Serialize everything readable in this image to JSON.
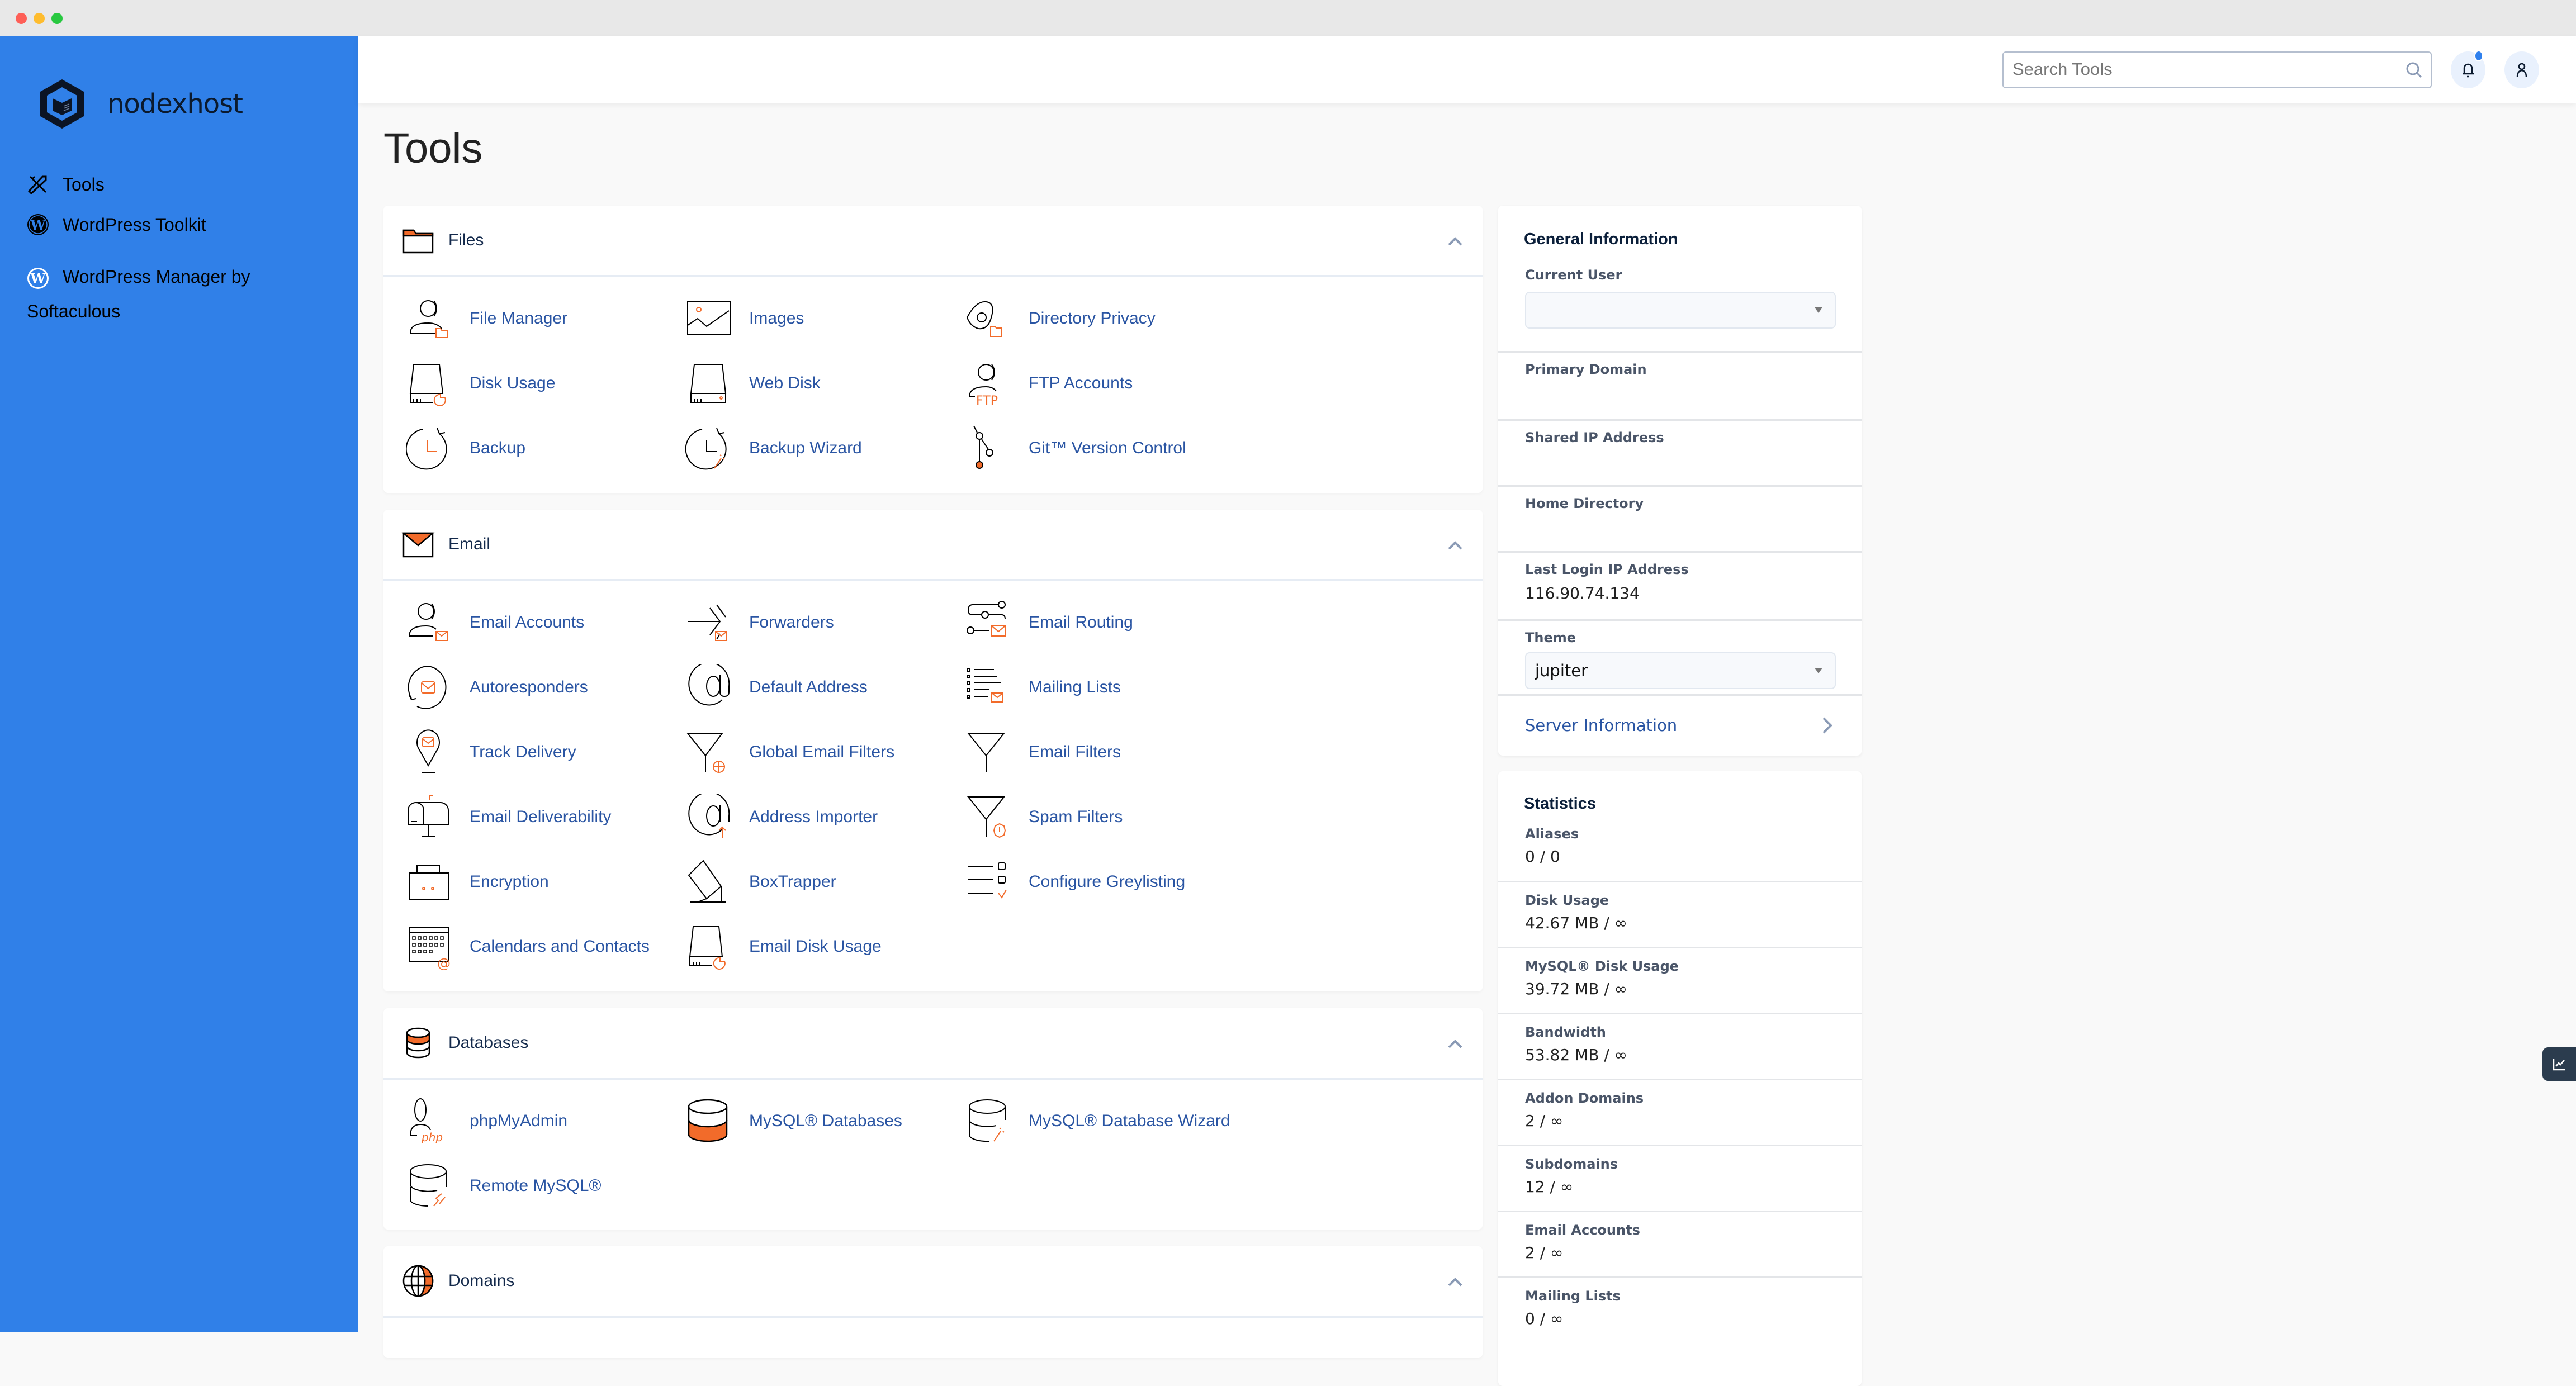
{
  "window": {
    "controls": [
      "close",
      "minimize",
      "maximize"
    ]
  },
  "brand": {
    "name": "nodexhost"
  },
  "sidebar": {
    "items": [
      {
        "label": "Tools",
        "icon": "tools-icon"
      },
      {
        "label": "WordPress Toolkit",
        "icon": "wordpress-icon"
      },
      {
        "label": "WordPress Manager by Softaculous",
        "icon": "wordpress-icon"
      }
    ]
  },
  "header": {
    "search_placeholder": "Search Tools",
    "search_value": "",
    "notifications_icon": "bell-icon",
    "user_icon": "user-icon"
  },
  "page": {
    "title": "Tools"
  },
  "sections": {
    "files": {
      "title": "Files",
      "tools": [
        "File Manager",
        "Images",
        "Directory Privacy",
        "Disk Usage",
        "Web Disk",
        "FTP Accounts",
        "Backup",
        "Backup Wizard",
        "Git™ Version Control"
      ]
    },
    "email": {
      "title": "Email",
      "tools": [
        "Email Accounts",
        "Forwarders",
        "Email Routing",
        "Autoresponders",
        "Default Address",
        "Mailing Lists",
        "Track Delivery",
        "Global Email Filters",
        "Email Filters",
        "Email Deliverability",
        "Address Importer",
        "Spam Filters",
        "Encryption",
        "BoxTrapper",
        "Configure Greylisting",
        "Calendars and Contacts",
        "Email Disk Usage"
      ]
    },
    "databases": {
      "title": "Databases",
      "tools": [
        "phpMyAdmin",
        "MySQL® Databases",
        "MySQL® Database Wizard",
        "Remote MySQL®"
      ]
    },
    "domains": {
      "title": "Domains"
    }
  },
  "general_info": {
    "title": "General Information",
    "current_user_label": "Current User",
    "current_user_value": "",
    "primary_domain_label": "Primary Domain",
    "primary_domain_value": "",
    "shared_ip_label": "Shared IP Address",
    "shared_ip_value": "",
    "home_dir_label": "Home Directory",
    "home_dir_value": "",
    "last_login_label": "Last Login IP Address",
    "last_login_value": "116.90.74.134",
    "theme_label": "Theme",
    "theme_value": "jupiter",
    "server_info_link": "Server Information"
  },
  "statistics": {
    "title": "Statistics",
    "items": [
      {
        "label": "Aliases",
        "value": "0 / 0"
      },
      {
        "label": "Disk Usage",
        "value": "42.67 MB / ∞"
      },
      {
        "label": "MySQL® Disk Usage",
        "value": "39.72 MB / ∞"
      },
      {
        "label": "Bandwidth",
        "value": "53.82 MB / ∞"
      },
      {
        "label": "Addon Domains",
        "value": "2 / ∞"
      },
      {
        "label": "Subdomains",
        "value": "12 / ∞"
      },
      {
        "label": "Email Accounts",
        "value": "2 / ∞"
      },
      {
        "label": "Mailing Lists",
        "value": "0 / ∞"
      }
    ]
  },
  "colors": {
    "sidebar": "#3080e8",
    "accent_orange": "#f26b2a",
    "link": "#2a55a3",
    "notification_dot": "#2f80ed"
  }
}
